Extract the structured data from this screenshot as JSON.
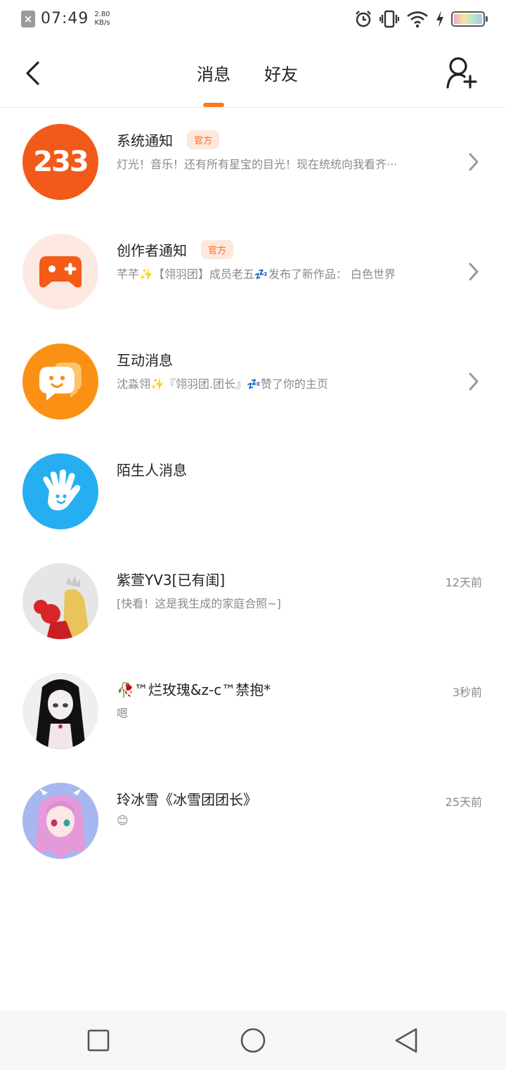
{
  "status_bar": {
    "time": "07:49",
    "speed_value": "2.80",
    "speed_unit": "KB/s",
    "notification_icon": "close-x-icon",
    "icons": [
      "alarm-icon",
      "vibrate-icon",
      "wifi-icon",
      "charging-icon",
      "battery-icon"
    ]
  },
  "header": {
    "back_icon": "chevron-left-icon",
    "tabs": [
      {
        "label": "消息",
        "active": true
      },
      {
        "label": "好友",
        "active": false
      }
    ],
    "add_friend_icon": "add-user-icon",
    "accent_color": "#ff7a1a"
  },
  "messages": [
    {
      "name": "系统通知",
      "badge": "官方",
      "preview": "灯光！音乐！还有所有星宝的目光！现在统统向我看齐···",
      "time": "",
      "avatar_text": "233",
      "has_chevron": true
    },
    {
      "name": "创作者通知",
      "badge": "官方",
      "preview": "芊芊✨【翎羽团】成员老五💤发布了新作品： 白色世界",
      "time": "",
      "has_chevron": true
    },
    {
      "name": "互动消息",
      "badge": "",
      "preview": "沈淼翎✨『翎羽团.团长』💤赞了你的主页",
      "time": "",
      "has_chevron": true
    },
    {
      "name": "陌生人消息",
      "badge": "",
      "preview": "",
      "time": "",
      "has_chevron": false
    },
    {
      "name": "紫萱YV3[已有闺]",
      "badge": "",
      "preview": "[快看！这是我生成的家庭合照~]",
      "time": "12天前",
      "has_chevron": false
    },
    {
      "name": "🥀™烂玫瑰&z-c™禁抱*",
      "badge": "",
      "preview": "嗯",
      "time": "3秒前",
      "has_chevron": false
    },
    {
      "name": "玲冰雪《冰雪团团长》",
      "badge": "",
      "preview": "😊",
      "time": "25天前",
      "has_chevron": false
    }
  ],
  "nav_bar": {
    "icons": [
      "recent-apps-icon",
      "home-icon",
      "back-triangle-icon"
    ]
  }
}
